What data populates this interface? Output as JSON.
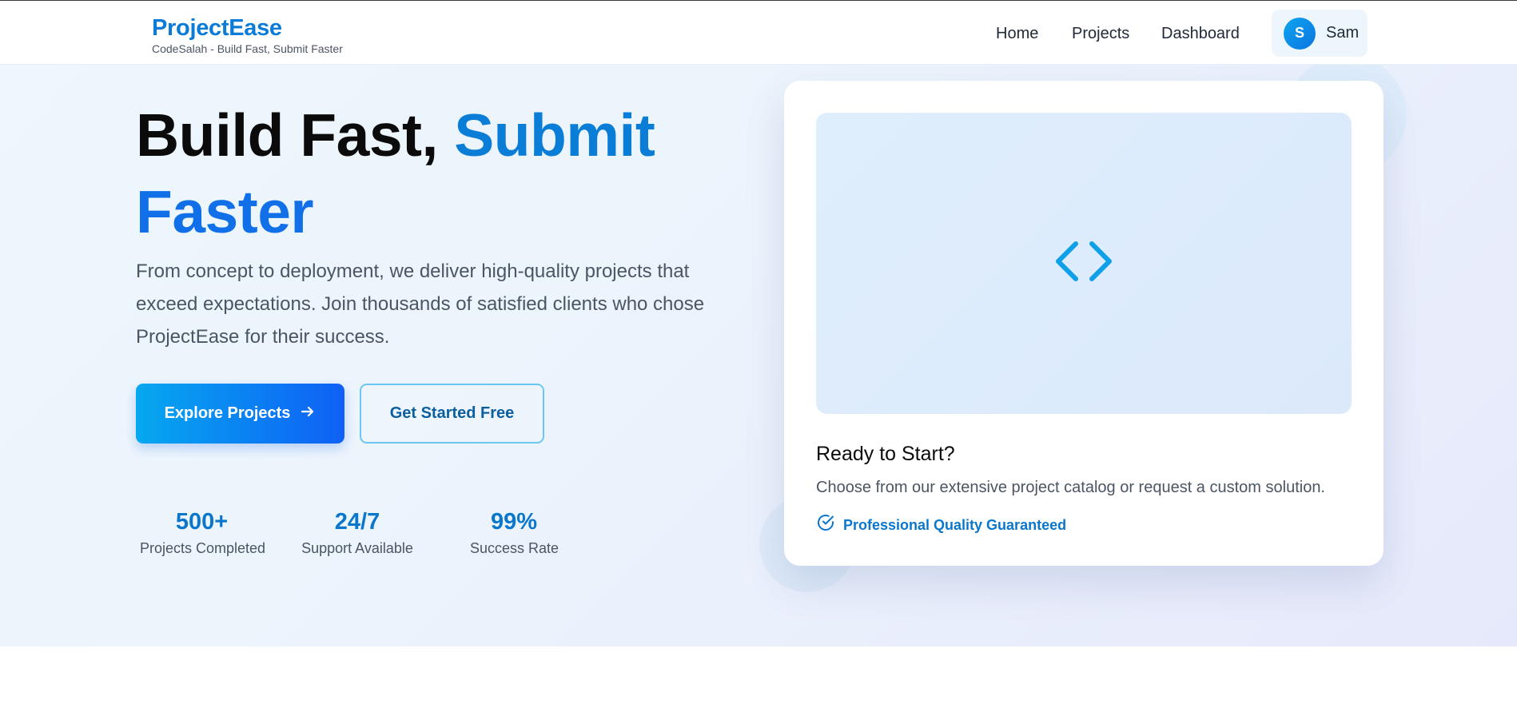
{
  "brand": {
    "title": "ProjectEase",
    "subtitle": "CodeSalah - Build Fast, Submit Faster"
  },
  "nav": {
    "links": [
      "Home",
      "Projects",
      "Dashboard"
    ],
    "user": {
      "initial": "S",
      "name": "Sam"
    }
  },
  "hero": {
    "headline_part1": "Build Fast,",
    "headline_part2": "Submit",
    "headline_part3": "Faster",
    "lead": "From concept to deployment, we deliver high-quality projects that exceed expectations. Join thousands of satisfied clients who chose ProjectEase for their success.",
    "primary_button": "Explore Projects",
    "secondary_button": "Get Started Free",
    "stats": [
      {
        "value": "500+",
        "label": "Projects Completed"
      },
      {
        "value": "24/7",
        "label": "Support Available"
      },
      {
        "value": "99%",
        "label": "Success Rate"
      }
    ]
  },
  "card": {
    "title": "Ready to Start?",
    "text": "Choose from our extensive project catalog or request a custom solution.",
    "badge": "Professional Quality Guaranteed",
    "icon": "code-icon"
  },
  "colors": {
    "brand_blue": "#0a7bd6",
    "accent_blue": "#1170e8",
    "primary_gradient_start": "#06a8f0",
    "primary_gradient_end": "#0f60f5"
  }
}
